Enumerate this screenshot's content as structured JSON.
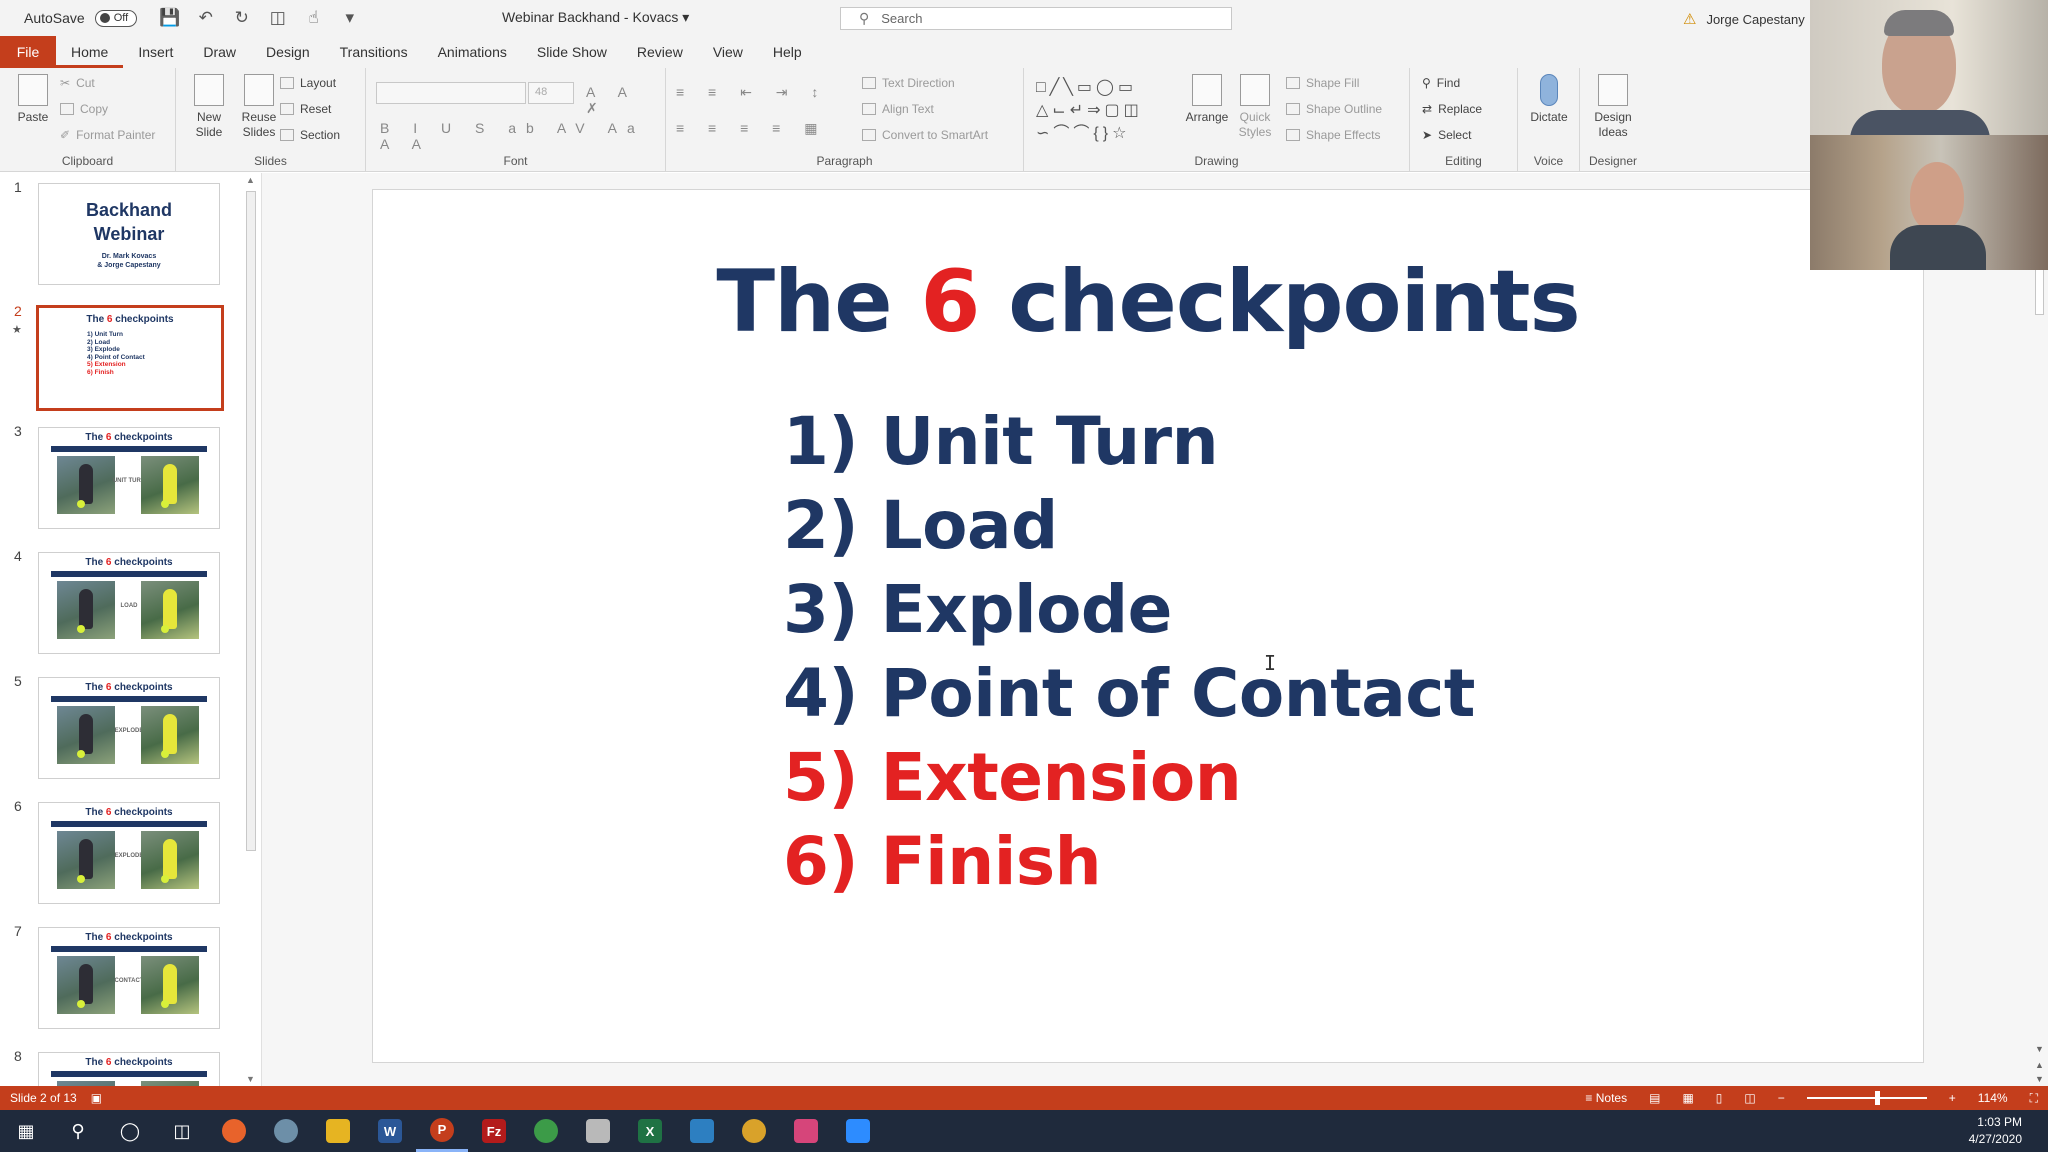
{
  "titlebar": {
    "autosave_label": "AutoSave",
    "autosave_state": "Off",
    "doc_title": "Webinar Backhand - Kovacs",
    "search_placeholder": "Search",
    "user_name": "Jorge Capestany"
  },
  "tabs": [
    "File",
    "Home",
    "Insert",
    "Draw",
    "Design",
    "Transitions",
    "Animations",
    "Slide Show",
    "Review",
    "View",
    "Help"
  ],
  "active_tab": "Home",
  "ribbon": {
    "clipboard": {
      "label": "Clipboard",
      "paste": "Paste",
      "cut": "Cut",
      "copy": "Copy",
      "format_painter": "Format Painter"
    },
    "slides": {
      "label": "Slides",
      "new_slide_1": "New",
      "new_slide_2": "Slide",
      "reuse_1": "Reuse",
      "reuse_2": "Slides",
      "layout": "Layout",
      "reset": "Reset",
      "section": "Section"
    },
    "font": {
      "label": "Font",
      "size": "48"
    },
    "paragraph": {
      "label": "Paragraph",
      "text_direction": "Text Direction",
      "align_text": "Align Text",
      "convert_smartart": "Convert to SmartArt"
    },
    "drawing": {
      "label": "Drawing",
      "arrange": "Arrange",
      "quick_styles_1": "Quick",
      "quick_styles_2": "Styles",
      "shape_fill": "Shape Fill",
      "shape_outline": "Shape Outline",
      "shape_effects": "Shape Effects"
    },
    "editing": {
      "label": "Editing",
      "find": "Find",
      "replace": "Replace",
      "select": "Select"
    },
    "voice": {
      "label": "Voice",
      "dictate": "Dictate"
    },
    "designer": {
      "label": "Designer",
      "design_ideas_1": "Design",
      "design_ideas_2": "Ideas"
    }
  },
  "thumbnails": {
    "slide1": {
      "num": "1",
      "title_1": "Backhand",
      "title_2": "Webinar",
      "sub_1": "Dr. Mark Kovacs",
      "sub_2": "& Jorge Capestany"
    },
    "slide2": {
      "num": "2",
      "title_pre": "The ",
      "title_num": "6",
      "title_post": " checkpoints",
      "items": [
        "1) Unit Turn",
        "2) Load",
        "3) Explode",
        "4) Point of Contact",
        "5) Extension",
        "6) Finish"
      ]
    },
    "photo_slides": [
      {
        "num": "3",
        "caption": "UNIT TURN"
      },
      {
        "num": "4",
        "caption": "LOAD"
      },
      {
        "num": "5",
        "caption": "EXPLODE"
      },
      {
        "num": "6",
        "caption": "EXPLODE"
      },
      {
        "num": "7",
        "caption": "CONTACT"
      },
      {
        "num": "8",
        "caption": ""
      }
    ],
    "photo_title_pre": "The ",
    "photo_title_num": "6",
    "photo_title_post": " checkpoints"
  },
  "slide": {
    "title_pre": "The ",
    "title_num": "6",
    "title_post": " checkpoints",
    "items": [
      {
        "text": "1) Unit Turn",
        "color": "#1f3764"
      },
      {
        "text": "2) Load",
        "color": "#1f3764"
      },
      {
        "text": "3) Explode",
        "color": "#1f3764"
      },
      {
        "text": "4) Point of Contact",
        "color": "#1f3764"
      },
      {
        "text": "5) Extension",
        "color": "#e32222"
      },
      {
        "text": "6) Finish",
        "color": "#e32222"
      }
    ]
  },
  "statusbar": {
    "slide_info": "Slide 2 of 13",
    "notes": "Notes",
    "zoom": "114%"
  },
  "taskbar": {
    "time": "1:03 PM",
    "date": "4/27/2020"
  },
  "colors": {
    "accent": "#c43e1c",
    "title_blue": "#1f3764",
    "highlight_red": "#e32222"
  }
}
